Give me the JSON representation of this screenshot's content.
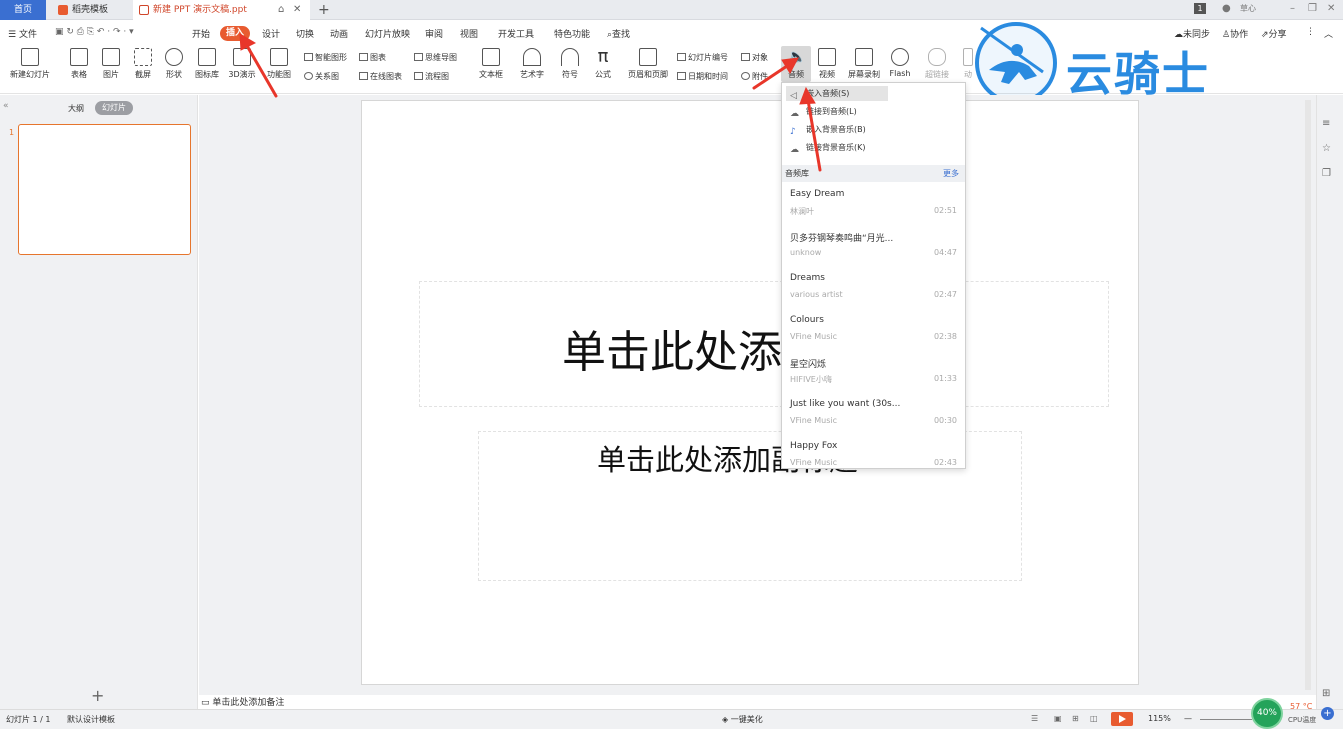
{
  "tabs": {
    "home": "首页",
    "template": "稻壳模板",
    "doc": "新建 PPT 演示文稿.ppt",
    "new": "+",
    "badge": "1",
    "user": "草心"
  },
  "menu": {
    "file": "文件",
    "items": [
      "开始",
      "插入",
      "设计",
      "切换",
      "动画",
      "幻灯片放映",
      "审阅",
      "视图",
      "开发工具",
      "特色功能"
    ],
    "search": "查找",
    "sync": "未同步",
    "collab": "协作",
    "share": "分享"
  },
  "ribbon": {
    "new_slide": "新建幻灯片",
    "table": "表格",
    "picture": "图片",
    "screenshot": "截屏",
    "shape": "形状",
    "icon_lib": "图标库",
    "3d": "3D演示",
    "func_chart": "功能图",
    "smart_shape": "智能图形",
    "chart": "图表",
    "relation": "关系图",
    "online_chart": "在线图表",
    "mindmap": "思维导图",
    "flowchart": "流程图",
    "textbox": "文本框",
    "wordart": "艺术字",
    "symbol": "符号",
    "formula": "公式",
    "header_footer": "页眉和页脚",
    "slide_num": "幻灯片编号",
    "datetime": "日期和时间",
    "object": "对象",
    "attachment": "附件",
    "audio": "音频",
    "video": "视频",
    "screen_record": "屏幕录制",
    "flash": "Flash",
    "hyperlink": "超链接",
    "action": "动"
  },
  "logo": {
    "text": "云骑士"
  },
  "left_panel": {
    "outline": "大纲",
    "slides": "幻灯片",
    "slide_number": "1",
    "add": "+"
  },
  "slide": {
    "title": "单击此处添",
    "subtitle": "单击此处添加副标题"
  },
  "notes": "单击此处添加备注",
  "dropdown": {
    "options": [
      "嵌入音频(S)",
      "链接到音频(L)",
      "嵌入背景音乐(B)",
      "链接背景音乐(K)"
    ],
    "library_label": "音频库",
    "more": "更多",
    "songs": [
      {
        "title": "Easy Dream",
        "artist": "林澜叶",
        "duration": "02:51"
      },
      {
        "title": "贝多芬钢琴奏鸣曲“月光...",
        "artist": "unknow",
        "duration": "04:47"
      },
      {
        "title": "Dreams",
        "artist": "various artist",
        "duration": "02:47"
      },
      {
        "title": "Colours",
        "artist": "VFine Music",
        "duration": "02:38"
      },
      {
        "title": "星空闪烁",
        "artist": "HIFIVE小嗨",
        "duration": "01:33"
      },
      {
        "title": "Just like you want (30s...",
        "artist": "VFine Music",
        "duration": "00:30"
      },
      {
        "title": "Happy Fox",
        "artist": "VFine Music",
        "duration": "02:43"
      }
    ]
  },
  "status": {
    "slide_count": "幻灯片 1 / 1",
    "template": "默认设计模板",
    "beautify": "一键美化",
    "zoom": "115%",
    "cpu": "40%",
    "temp": "57 °C",
    "cpu_label": "CPU温度"
  },
  "colors": {
    "accent": "#e85b30",
    "brand": "#3a6fd1",
    "logo": "#2a8be0"
  }
}
